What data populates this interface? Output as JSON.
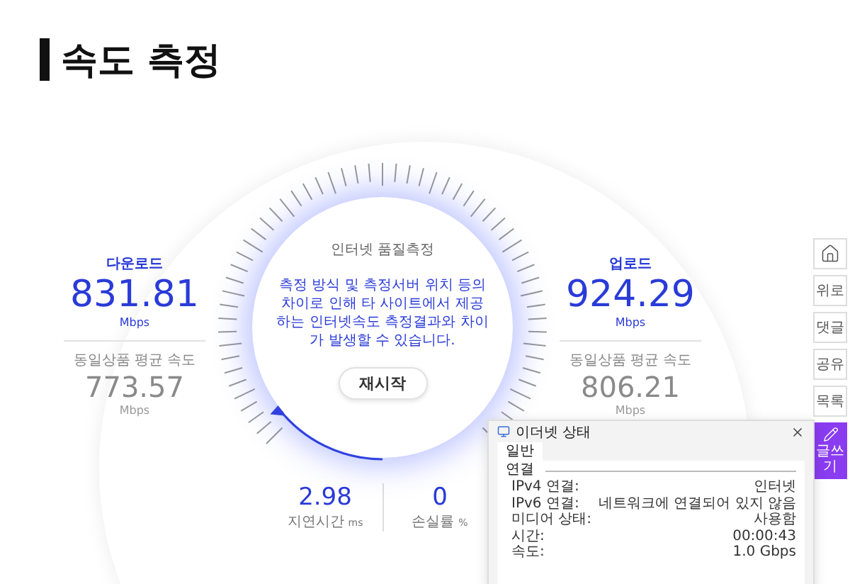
{
  "page_title": "속도 측정",
  "download": {
    "label": "다운로드",
    "value": "831.81",
    "unit": "Mbps",
    "avg_label": "동일상품 평균 속도",
    "avg_value": "773.57",
    "avg_unit": "Mbps"
  },
  "upload": {
    "label": "업로드",
    "value": "924.29",
    "unit": "Mbps",
    "avg_label": "동일상품 평균 속도",
    "avg_value": "806.21",
    "avg_unit": "Mbps"
  },
  "dial": {
    "title": "인터넷 품질측정",
    "notice": "측정 방식 및 측정서버 위치 등의 차이로 인해 타 사이트에서 제공하는 인터넷속도 측정결과와 차이가 발생할 수 있습니다.",
    "button": "재시작"
  },
  "metrics": [
    {
      "value": "2.98",
      "label": "지연시간",
      "unit": "ms"
    },
    {
      "value": "0",
      "label": "손실률",
      "unit": "%"
    }
  ],
  "side_menu": [
    {
      "kind": "icon",
      "selected": false
    },
    {
      "kind": "text",
      "label": "위로",
      "selected": false
    },
    {
      "kind": "text",
      "label": "댓글",
      "selected": false
    },
    {
      "kind": "text",
      "label": "공유",
      "selected": false
    },
    {
      "kind": "text",
      "label": "목록",
      "selected": false
    },
    {
      "kind": "write",
      "label": "글쓰기",
      "selected": true
    }
  ],
  "status_window": {
    "title": "이더넷 상태",
    "tabs": [
      {
        "label": "일반",
        "selected": true
      }
    ],
    "section": "연결",
    "rows": [
      {
        "label": "IPv4 연결:",
        "value": "인터넷"
      },
      {
        "label": "IPv6 연결:",
        "value": "네트워크에 연결되어 있지 않음"
      },
      {
        "label": "미디어 상태:",
        "value": "사용함"
      },
      {
        "label": "시간:",
        "value": "00:00:43"
      },
      {
        "label": "속도:",
        "value": "1.0 Gbps"
      }
    ]
  }
}
